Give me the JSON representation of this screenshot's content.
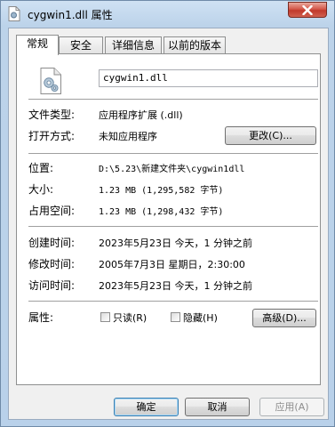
{
  "window": {
    "title": "cygwin1.dll 属性"
  },
  "tabs": [
    {
      "label": "常规"
    },
    {
      "label": "安全"
    },
    {
      "label": "详细信息"
    },
    {
      "label": "以前的版本"
    }
  ],
  "general": {
    "file_name": "cygwin1.dll",
    "file_type_label": "文件类型:",
    "file_type_value": "应用程序扩展 (.dll)",
    "open_with_label": "打开方式:",
    "open_with_value": "未知应用程序",
    "change_button": "更改(C)...",
    "location_label": "位置:",
    "location_value": "D:\\5.23\\新建文件夹\\cygwin1dll",
    "size_label": "大小:",
    "size_value": "1.23 MB (1,295,582 字节)",
    "size_on_disk_label": "占用空间:",
    "size_on_disk_value": "1.23 MB (1,298,432 字节)",
    "created_label": "创建时间:",
    "created_value": "2023年5月23日 今天，1 分钟之前",
    "modified_label": "修改时间:",
    "modified_value": "2005年7月3日 星期日，2:30:00",
    "accessed_label": "访问时间:",
    "accessed_value": "2023年5月23日 今天，1 分钟之前",
    "attributes_label": "属性:",
    "readonly_label": "只读(R)",
    "hidden_label": "隐藏(H)",
    "advanced_button": "高级(D)..."
  },
  "footer": {
    "ok": "确定",
    "cancel": "取消",
    "apply": "应用(A)"
  }
}
